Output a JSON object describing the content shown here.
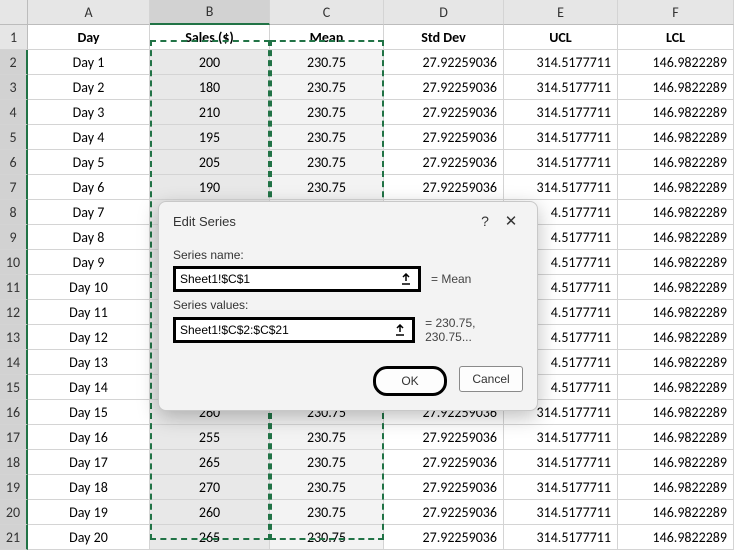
{
  "columns": [
    "A",
    "B",
    "C",
    "D",
    "E",
    "F"
  ],
  "headers": {
    "A": "Day",
    "B": "Sales ($)",
    "C": "Mean",
    "D": "Std Dev",
    "E": "UCL",
    "F": "LCL"
  },
  "rows": [
    {
      "n": 2,
      "day": "Day 1",
      "sales": "200",
      "mean": "230.75",
      "std": "27.92259036",
      "ucl": "314.5177711",
      "lcl": "146.9822289"
    },
    {
      "n": 3,
      "day": "Day 2",
      "sales": "180",
      "mean": "230.75",
      "std": "27.92259036",
      "ucl": "314.5177711",
      "lcl": "146.9822289"
    },
    {
      "n": 4,
      "day": "Day 3",
      "sales": "210",
      "mean": "230.75",
      "std": "27.92259036",
      "ucl": "314.5177711",
      "lcl": "146.9822289"
    },
    {
      "n": 5,
      "day": "Day 4",
      "sales": "195",
      "mean": "230.75",
      "std": "27.92259036",
      "ucl": "314.5177711",
      "lcl": "146.9822289"
    },
    {
      "n": 6,
      "day": "Day 5",
      "sales": "205",
      "mean": "230.75",
      "std": "27.92259036",
      "ucl": "314.5177711",
      "lcl": "146.9822289"
    },
    {
      "n": 7,
      "day": "Day 6",
      "sales": "190",
      "mean": "230.75",
      "std": "27.92259036",
      "ucl": "314.5177711",
      "lcl": "146.9822289"
    },
    {
      "n": 8,
      "day": "Day 7",
      "sales": "",
      "mean": "",
      "std": "",
      "ucl": "4.5177711",
      "lcl": "146.9822289"
    },
    {
      "n": 9,
      "day": "Day 8",
      "sales": "",
      "mean": "",
      "std": "",
      "ucl": "4.5177711",
      "lcl": "146.9822289"
    },
    {
      "n": 10,
      "day": "Day 9",
      "sales": "",
      "mean": "",
      "std": "",
      "ucl": "4.5177711",
      "lcl": "146.9822289"
    },
    {
      "n": 11,
      "day": "Day 10",
      "sales": "",
      "mean": "",
      "std": "",
      "ucl": "4.5177711",
      "lcl": "146.9822289"
    },
    {
      "n": 12,
      "day": "Day 11",
      "sales": "",
      "mean": "",
      "std": "",
      "ucl": "4.5177711",
      "lcl": "146.9822289"
    },
    {
      "n": 13,
      "day": "Day 12",
      "sales": "",
      "mean": "",
      "std": "",
      "ucl": "4.5177711",
      "lcl": "146.9822289"
    },
    {
      "n": 14,
      "day": "Day 13",
      "sales": "",
      "mean": "",
      "std": "",
      "ucl": "4.5177711",
      "lcl": "146.9822289"
    },
    {
      "n": 15,
      "day": "Day 14",
      "sales": "",
      "mean": "",
      "std": "",
      "ucl": "4.5177711",
      "lcl": "146.9822289"
    },
    {
      "n": 16,
      "day": "Day 15",
      "sales": "260",
      "mean": "230.75",
      "std": "27.92259036",
      "ucl": "314.5177711",
      "lcl": "146.9822289"
    },
    {
      "n": 17,
      "day": "Day 16",
      "sales": "255",
      "mean": "230.75",
      "std": "27.92259036",
      "ucl": "314.5177711",
      "lcl": "146.9822289"
    },
    {
      "n": 18,
      "day": "Day 17",
      "sales": "265",
      "mean": "230.75",
      "std": "27.92259036",
      "ucl": "314.5177711",
      "lcl": "146.9822289"
    },
    {
      "n": 19,
      "day": "Day 18",
      "sales": "270",
      "mean": "230.75",
      "std": "27.92259036",
      "ucl": "314.5177711",
      "lcl": "146.9822289"
    },
    {
      "n": 20,
      "day": "Day 19",
      "sales": "260",
      "mean": "230.75",
      "std": "27.92259036",
      "ucl": "314.5177711",
      "lcl": "146.9822289"
    },
    {
      "n": 21,
      "day": "Day 20",
      "sales": "265",
      "mean": "230.75",
      "std": "27.92259036",
      "ucl": "314.5177711",
      "lcl": "146.9822289"
    }
  ],
  "row1_label": "1",
  "dialog": {
    "title": "Edit Series",
    "help": "?",
    "close": "✕",
    "name_label": "Series name:",
    "name_value": "Sheet1!$C$1",
    "name_result": "= Mean",
    "values_label": "Series values:",
    "values_value": "Sheet1!$C$2:$C$21",
    "values_result": "= 230.75, 230.75...",
    "ok": "OK",
    "cancel": "Cancel"
  }
}
